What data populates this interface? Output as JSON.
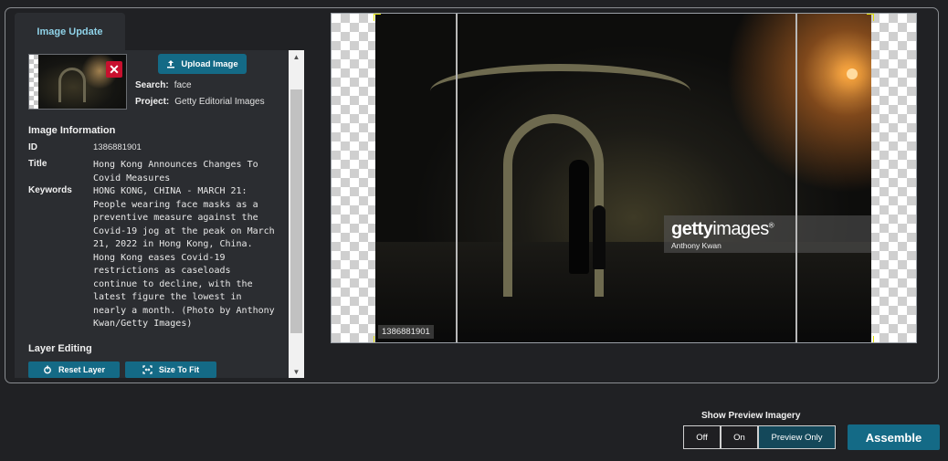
{
  "tab": {
    "label": "Image Update"
  },
  "upload": {
    "label": "Upload Image"
  },
  "search": {
    "label": "Search:",
    "value": "face"
  },
  "project": {
    "label": "Project:",
    "value": "Getty Editorial Images"
  },
  "info": {
    "title": "Image Information",
    "id_label": "ID",
    "id_value": "1386881901",
    "title_label": "Title",
    "title_value": "Hong Kong Announces Changes To Covid Measures",
    "keywords_label": "Keywords",
    "keywords_value": "HONG KONG, CHINA - MARCH 21: People wearing face masks as a preventive measure against the Covid-19 jog at the peak on March 21, 2022 in Hong Kong, China. Hong Kong eases Covid-19 restrictions as caseloads continue to decline, with the latest figure the lowest in nearly a month. (Photo by Anthony Kwan/Getty Images)"
  },
  "layer_editing": {
    "title": "Layer Editing",
    "reset_label": "Reset Layer",
    "size_label": "Size To Fit"
  },
  "preview_image": {
    "watermark_logo_bold": "getty",
    "watermark_logo_light": "images",
    "watermark_reg": "®",
    "watermark_credit": "Anthony Kwan",
    "image_id": "1386881901"
  },
  "preview_controls": {
    "title": "Show Preview Imagery",
    "options": [
      "Off",
      "On",
      "Preview Only"
    ],
    "selected": "Preview Only"
  },
  "assemble": {
    "label": "Assemble"
  },
  "colors": {
    "accent": "#146a86",
    "remove": "#c8102e",
    "tab_text": "#8fd2e8",
    "guide": "#e0e000"
  },
  "icons": {
    "remove": "close-icon",
    "upload": "upload-icon",
    "reset": "reset-icon",
    "size": "fit-icon"
  }
}
